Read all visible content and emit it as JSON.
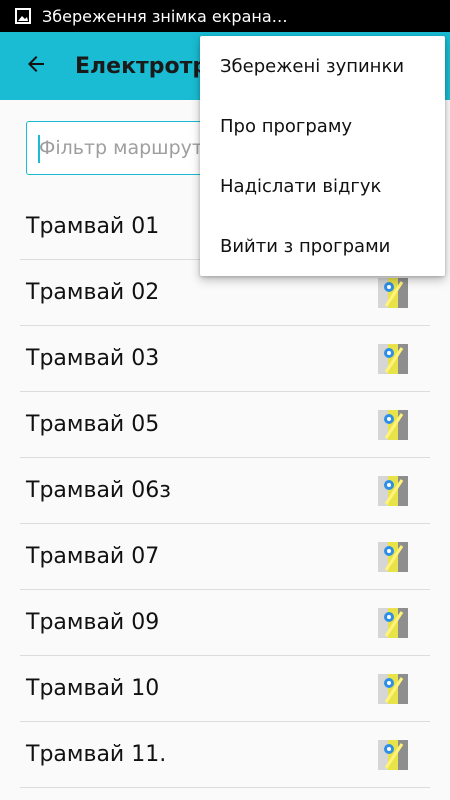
{
  "status_bar": {
    "notification_text": "Збереження знімка екрана…",
    "icon": "image-icon"
  },
  "app_bar": {
    "title": "Електротранспорт",
    "back_icon": "arrow-left-icon",
    "color": "#19bcd2"
  },
  "filter": {
    "placeholder": "Фільтр маршрутів",
    "value": ""
  },
  "routes": [
    {
      "name": "Трамвай 01"
    },
    {
      "name": "Трамвай 02"
    },
    {
      "name": "Трамвай 03"
    },
    {
      "name": "Трамвай 05"
    },
    {
      "name": "Трамвай 06з"
    },
    {
      "name": "Трамвай 07"
    },
    {
      "name": "Трамвай 09"
    },
    {
      "name": "Трамвай 10"
    },
    {
      "name": "Трамвай 11."
    }
  ],
  "overflow_menu": {
    "items": [
      {
        "label": "Збережені зупинки"
      },
      {
        "label": "Про програму"
      },
      {
        "label": "Надіслати відгук"
      },
      {
        "label": "Вийти з програми"
      }
    ]
  }
}
